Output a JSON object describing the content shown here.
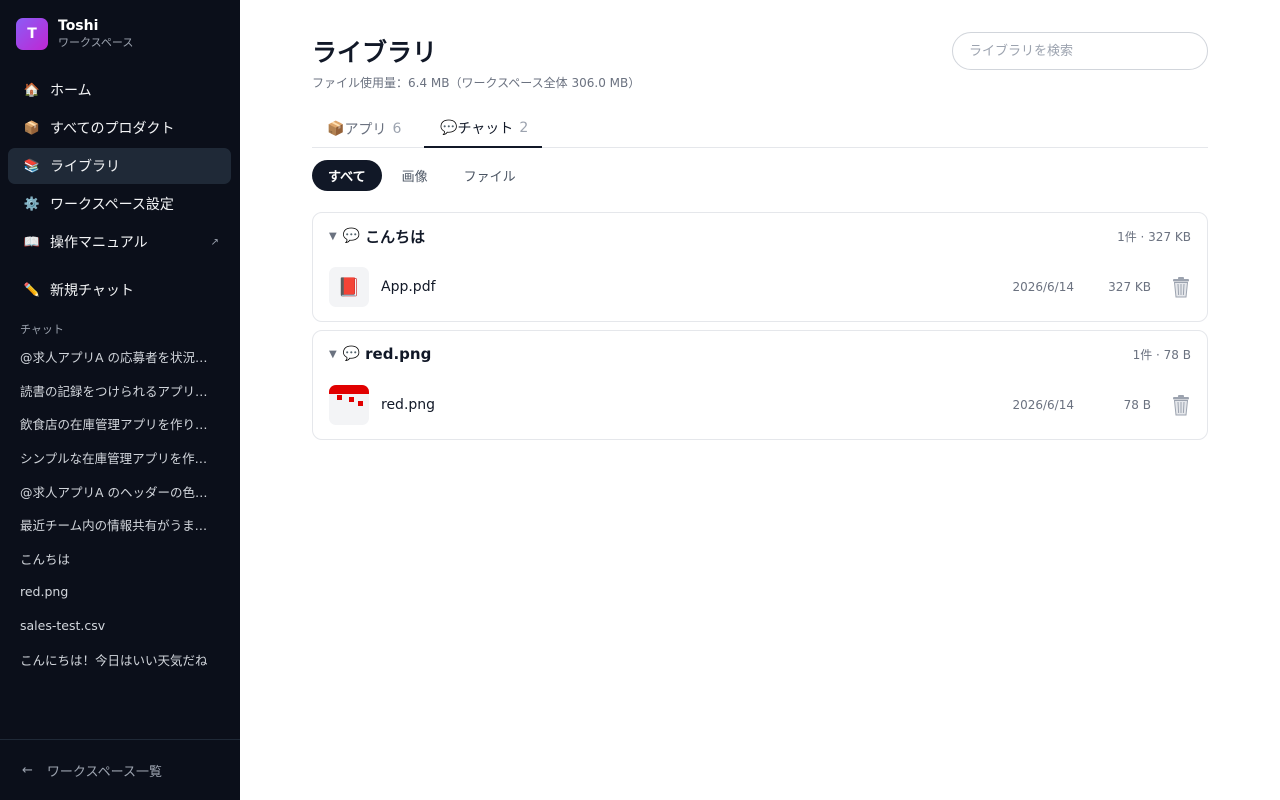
{
  "sidebar": {
    "workspace": {
      "initial": "T",
      "name": "Toshi",
      "subtitle": "ワークスペース"
    },
    "nav": [
      {
        "icon": "🏠",
        "label": "ホーム"
      },
      {
        "icon": "📦",
        "label": "すべてのプロダクト"
      },
      {
        "icon": "📚",
        "label": "ライブラリ"
      },
      {
        "icon": "⚙️",
        "label": "ワークスペース設定"
      },
      {
        "icon": "📖",
        "label": "操作マニュアル",
        "external": "↗"
      }
    ],
    "new_chat": {
      "icon": "✏️",
      "label": "新規チャット"
    },
    "chats_label": "チャット",
    "chats": [
      "@求人アプリA の応募者を状況別に管理したい",
      "読書の記録をつけられるアプリを作りたい",
      "飲食店の在庫管理アプリを作りたい",
      "シンプルな在庫管理アプリを作りたい",
      "@求人アプリA のヘッダーの色を変更して",
      "最近チーム内の情報共有がうまくいかない",
      "こんちは",
      "red.png",
      "sales-test.csv",
      "こんにちは！今日はいい天気だね"
    ],
    "footer": {
      "arrow": "←",
      "label": "ワークスペース一覧"
    }
  },
  "main": {
    "title": "ライブラリ",
    "usage": "ファイル使用量：6.4 MB（ワークスペース全体 306.0 MB）",
    "search_placeholder": "ライブラリを検索",
    "tabs": [
      {
        "icon": "📦",
        "label": "アプリ",
        "count": "6"
      },
      {
        "icon": "💬",
        "label": "チャット",
        "count": "2"
      }
    ],
    "active_tab": "チャット",
    "filters": [
      "すべて",
      "画像",
      "ファイル"
    ],
    "active_filter": "すべて",
    "groups": [
      {
        "caret": "▼",
        "icon": "💬",
        "title": "こんちは",
        "meta": "1件 · 327 KB",
        "files": [
          {
            "thumb_icon": "📕",
            "name": "App.pdf",
            "date": "2026/6/14",
            "size": "327 KB"
          }
        ]
      },
      {
        "caret": "▼",
        "icon": "💬",
        "title": "red.png",
        "meta": "1件 · 78 B",
        "files": [
          {
            "thumb_icon": "red-image-thumbnail",
            "name": "red.png",
            "date": "2026/6/14",
            "size": "78 B"
          }
        ]
      }
    ]
  },
  "colors": {
    "sidebar_bg": "#0b0f1a",
    "sidebar_active": "#1f2937",
    "accent_dark": "#111827",
    "avatar_gradient": [
      "#8b5cf6",
      "#c026d3"
    ],
    "image_red": "#e10000"
  }
}
